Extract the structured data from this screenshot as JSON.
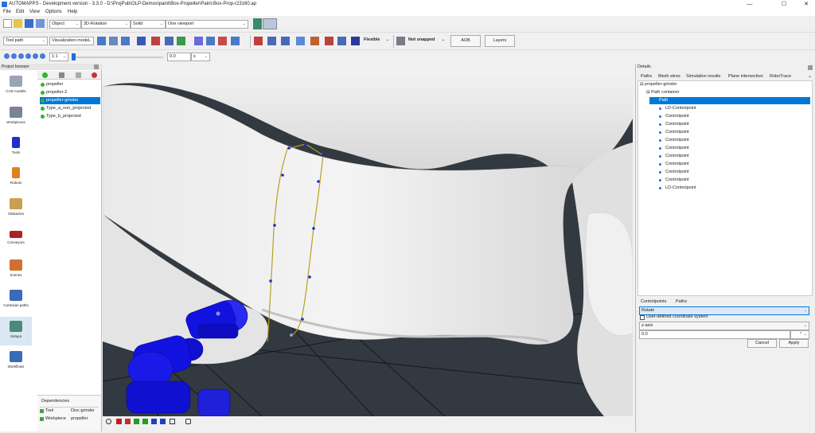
{
  "window": {
    "title": "AUTOMAPPS - Development version - 3.3.0 - D:\\ProjPub\\OLP-Demos\\paint\\Box-Propeller\\Paint-Box-Prop-r23160.ap",
    "min": "—",
    "max": "☐",
    "close": "✕"
  },
  "menu": [
    "File",
    "Edit",
    "View",
    "Options",
    "Help"
  ],
  "toolbar1": {
    "mode": "Object",
    "rotation": "3D-Rotation",
    "render": "Solid",
    "viewport": "One viewport"
  },
  "toolbar2": {
    "path_type": "Tool path",
    "model": "Visualization model",
    "flexible": "Flexible",
    "snap": "Not snapped",
    "aob": "AOB",
    "layers": "Layers"
  },
  "toolbar3": {
    "ratio": "1:1",
    "value": "0.0",
    "unit": "s"
  },
  "slider": {
    "fraction": 0.0
  },
  "project_browser": {
    "title": "Project browser",
    "categories": [
      "CAD models",
      "Workpieces",
      "Tools",
      "Robots",
      "Obstacles",
      "Conveyors",
      "Scenes",
      "Cartesian paths",
      "Setups",
      "Workflows"
    ],
    "items": [
      "propeller",
      "propeller-2",
      "propeller-grinder",
      "Type_a_non_projected",
      "Type_b_projected"
    ],
    "selected": 2,
    "dependencies_title": "Dependencies",
    "dependencies": [
      {
        "type": "Tool",
        "value": "Disc-grinder"
      },
      {
        "type": "Workpiece",
        "value": "propeller"
      }
    ]
  },
  "details": {
    "title": "Details",
    "tabs": [
      "Paths",
      "Mesh wires",
      "Simulation results",
      "Plane intersection",
      "RoboTrace"
    ],
    "tree_root": "propeller-grinder",
    "container": "Path container",
    "path": "Path",
    "points": [
      "LD-Controlpoint",
      "Controlpoint",
      "Controlpoint",
      "Controlpoint",
      "Controlpoint",
      "Controlpoint",
      "Controlpoint",
      "Controlpoint",
      "Controlpoint",
      "Controlpoint",
      "LD-Controlpoint"
    ],
    "lower_tabs": [
      "Controlpoints",
      "Paths"
    ],
    "operation": "Rotate",
    "user_cs_label": "User-defined coordinate system",
    "axis": "z-axis",
    "amount": "0.0",
    "amount_unit": "°",
    "cancel": "Cancel",
    "apply": "Apply"
  },
  "colors": {
    "accent": "#0078d7",
    "robot": "#1010e0",
    "path": "#b8a020",
    "selection": "#0078d7"
  }
}
